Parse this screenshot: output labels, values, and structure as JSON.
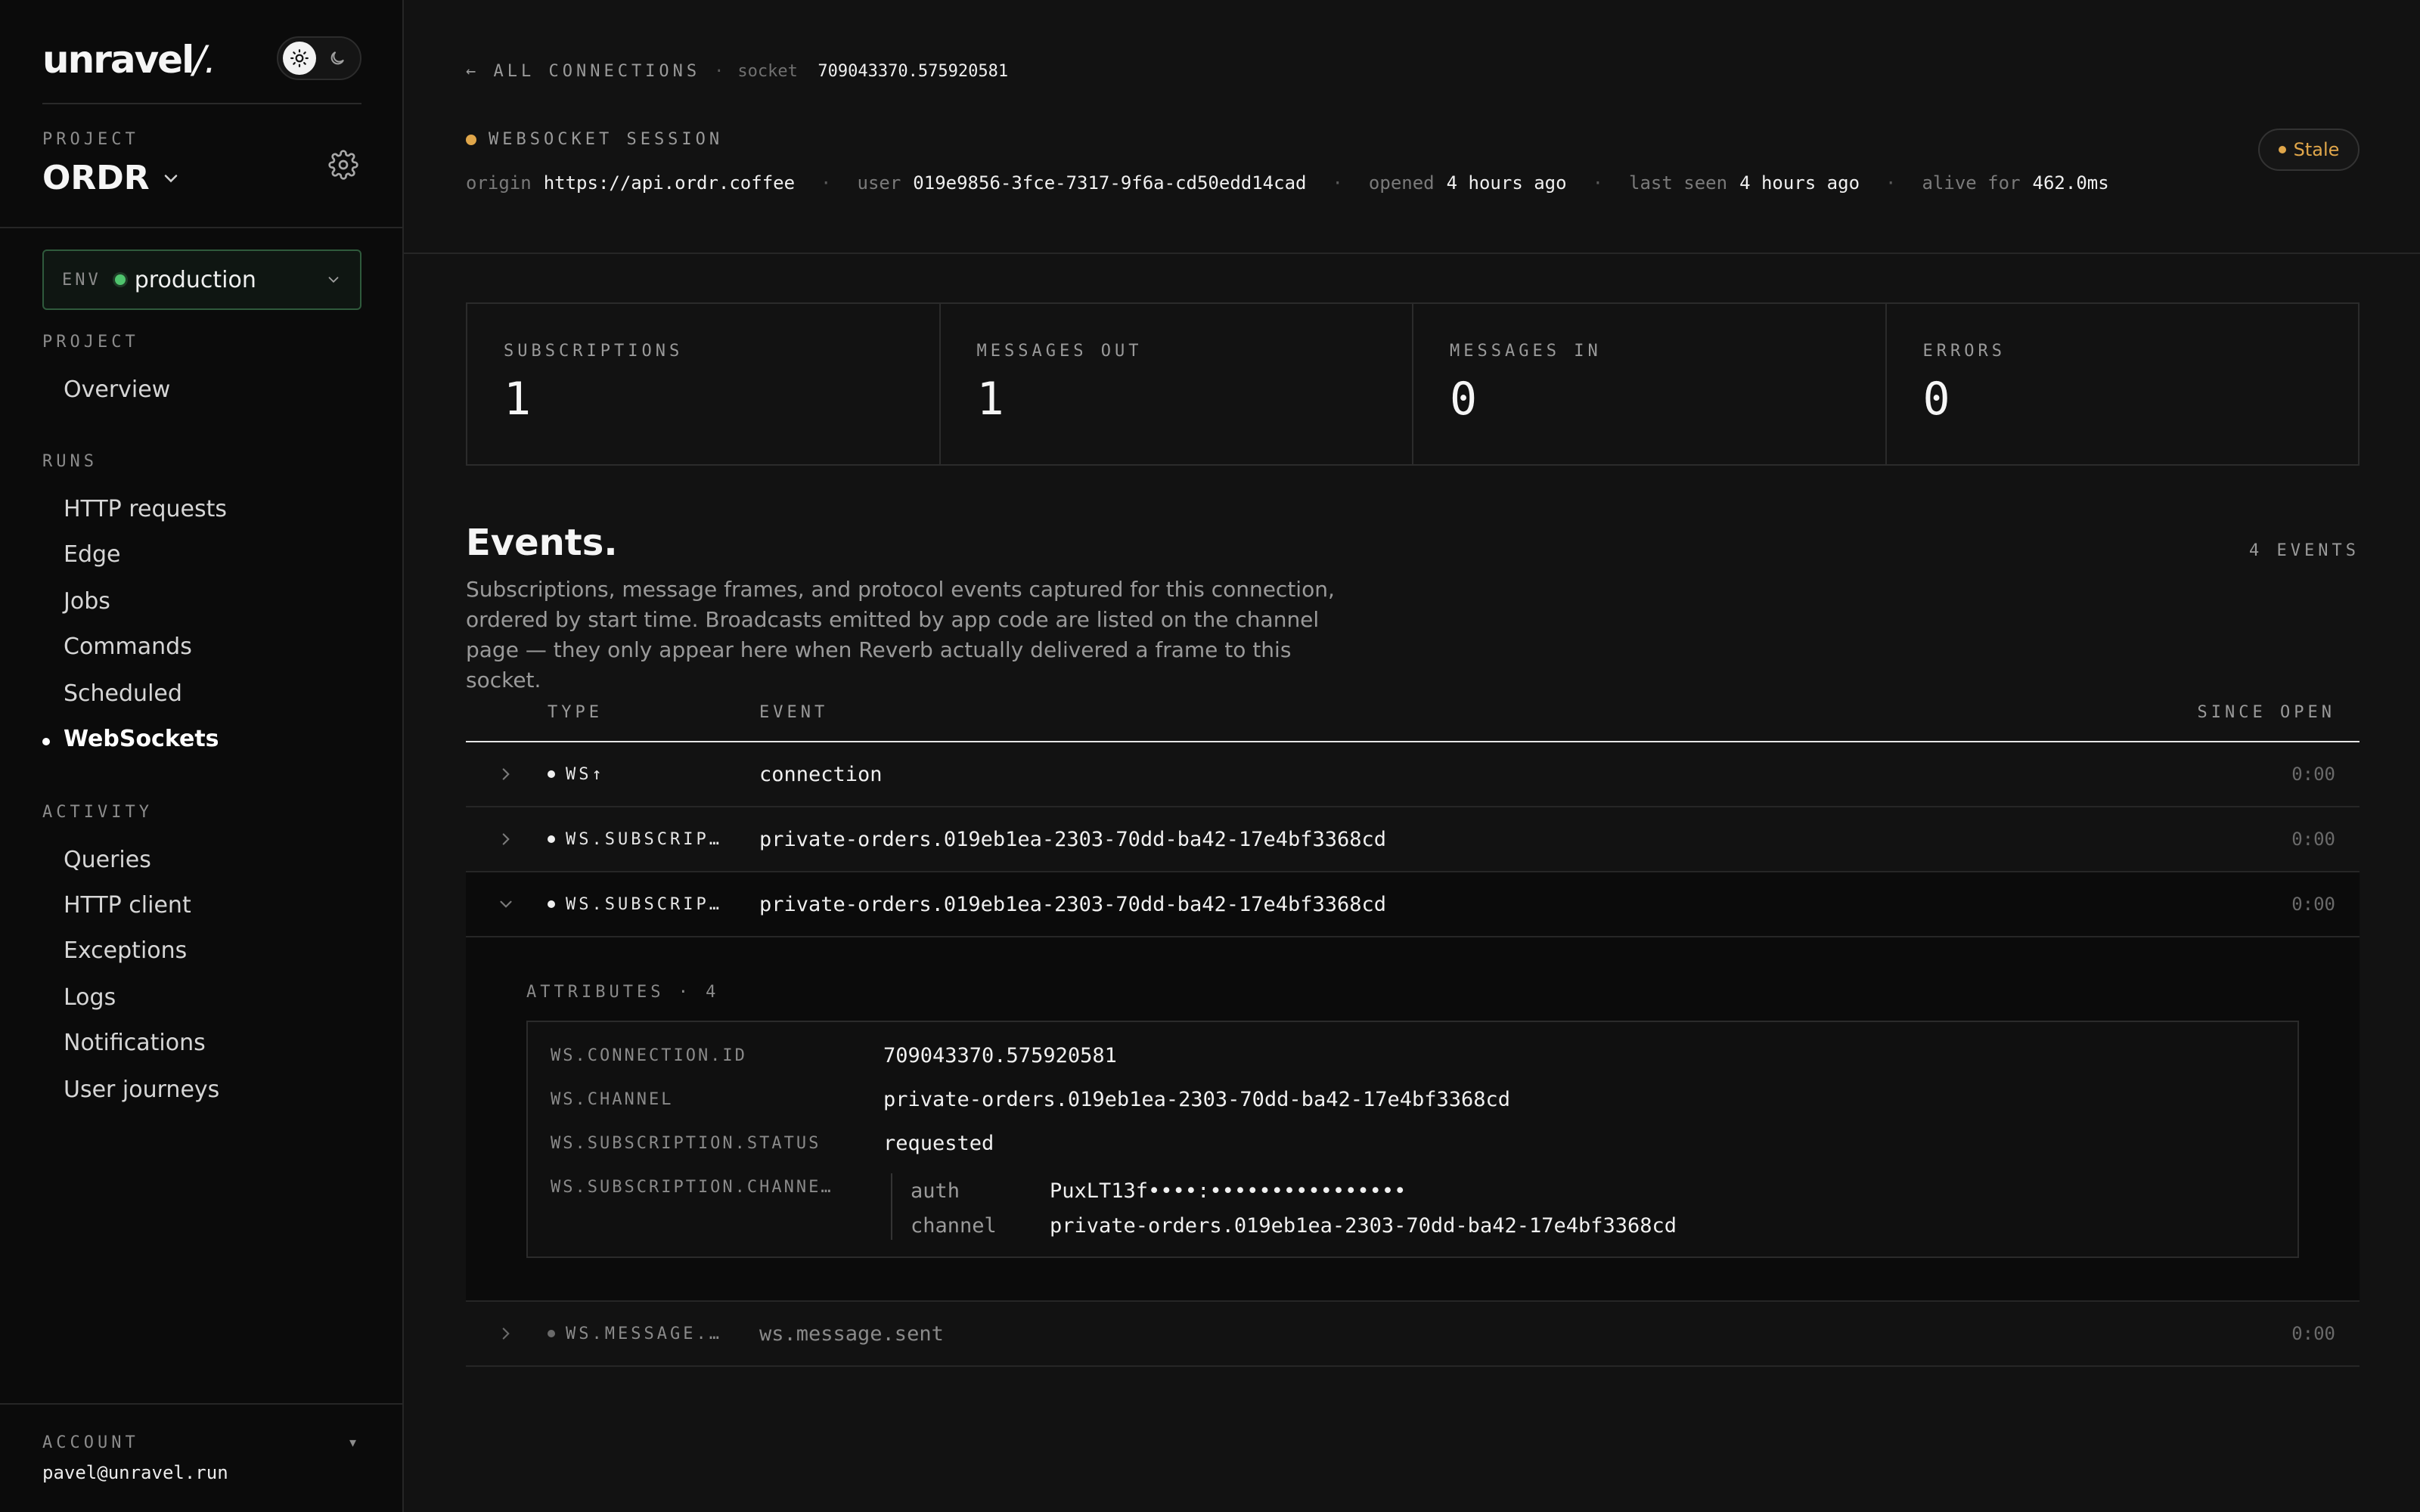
{
  "sidebar": {
    "logo": "unravel",
    "logo_suffix": "/.",
    "project_label": "PROJECT",
    "project_name": "ORDR",
    "env_label": "ENV",
    "env_value": "production",
    "sections": [
      {
        "title": "PROJECT",
        "items": [
          "Overview"
        ]
      },
      {
        "title": "RUNS",
        "items": [
          "HTTP requests",
          "Edge",
          "Jobs",
          "Commands",
          "Scheduled",
          "WebSockets"
        ]
      },
      {
        "title": "ACTIVITY",
        "items": [
          "Queries",
          "HTTP client",
          "Exceptions",
          "Logs",
          "Notifications",
          "User journeys"
        ]
      }
    ],
    "active_item": "WebSockets",
    "account_label": "ACCOUNT",
    "account_email": "pavel@unravel.run"
  },
  "breadcrumb": {
    "back_label": "← ALL CONNECTIONS",
    "separator": "·",
    "socket_key": "socket",
    "socket_value": "709043370.575920581"
  },
  "session": {
    "kicker": "WEBSOCKET SESSION",
    "status_badge": "Stale",
    "origin_key": "origin",
    "origin_value": "https://api.ordr.coffee",
    "user_key": "user",
    "user_value": "019e9856-3fce-7317-9f6a-cd50edd14cad",
    "opened_key": "opened",
    "opened_value": "4 hours ago",
    "last_seen_key": "last seen",
    "last_seen_value": "4 hours ago",
    "alive_key": "alive for",
    "alive_value": "462.0ms",
    "meta_sep": "·"
  },
  "stats": [
    {
      "label": "SUBSCRIPTIONS",
      "value": "1"
    },
    {
      "label": "MESSAGES OUT",
      "value": "1"
    },
    {
      "label": "MESSAGES IN",
      "value": "0"
    },
    {
      "label": "ERRORS",
      "value": "0"
    }
  ],
  "events": {
    "title": "Events.",
    "count": "4 EVENTS",
    "description": "Subscriptions, message frames, and protocol events captured for this connection, ordered by start time. Broadcasts emitted by app code are listed on the channel page — they only appear here when Reverb actually delivered a frame to this socket.",
    "columns": {
      "type": "TYPE",
      "event": "EVENT",
      "since": "SINCE OPEN"
    },
    "rows": [
      {
        "type": "WS↑",
        "event": "connection",
        "since": "0:00"
      },
      {
        "type": "WS.SUBSCRIP…",
        "event": "private-orders.019eb1ea-2303-70dd-ba42-17e4bf3368cd",
        "since": "0:00"
      },
      {
        "type": "WS.SUBSCRIP…",
        "event": "private-orders.019eb1ea-2303-70dd-ba42-17e4bf3368cd",
        "since": "0:00"
      },
      {
        "type": "WS.MESSAGE.…",
        "event": "ws.message.sent",
        "since": "0:00"
      }
    ],
    "expanded": {
      "attributes_label": "ATTRIBUTES · 4",
      "attributes": [
        {
          "key": "WS.CONNECTION.ID",
          "value": "709043370.575920581"
        },
        {
          "key": "WS.CHANNEL",
          "value": "private-orders.019eb1ea-2303-70dd-ba42-17e4bf3368cd"
        },
        {
          "key": "WS.SUBSCRIPTION.STATUS",
          "value": "requested"
        },
        {
          "key": "WS.SUBSCRIPTION.CHANNE…",
          "value": ""
        }
      ],
      "nested": [
        {
          "key": "auth",
          "value": "PuxLT13f••••:••••••••••••••••"
        },
        {
          "key": "channel",
          "value": "private-orders.019eb1ea-2303-70dd-ba42-17e4bf3368cd"
        }
      ]
    }
  },
  "colors": {
    "accent_amber": "#e0a64a",
    "env_green": "#4fc46d",
    "background": "#121212",
    "sidebar": "#0b0b0b"
  }
}
